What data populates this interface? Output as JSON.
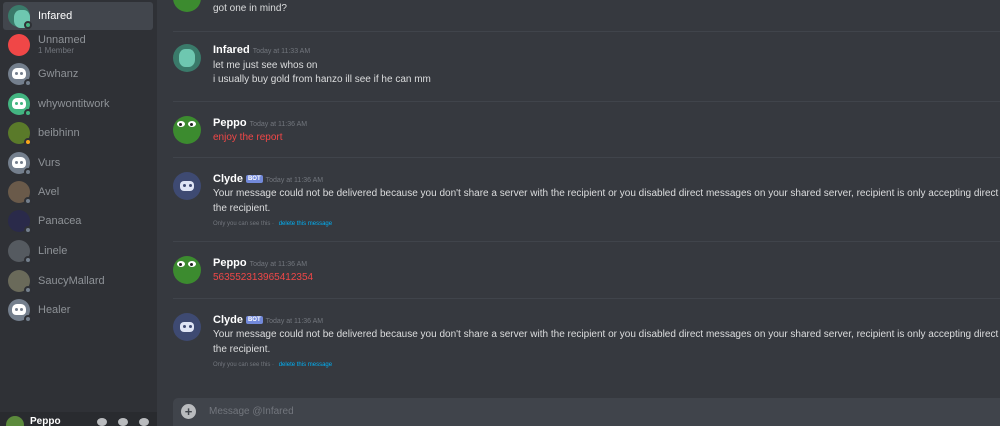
{
  "sidebar": {
    "dms": [
      {
        "name": "Infared",
        "status": "online",
        "avatar_color": "#3a7a6a",
        "active": true
      },
      {
        "name": "Unnamed",
        "sub": "1 Member",
        "avatar_color": "#f04747",
        "group": true
      },
      {
        "name": "Gwhanz",
        "status": "offline",
        "avatar_color": "#747f8d"
      },
      {
        "name": "whywontitwork",
        "status": "online",
        "avatar_color": "#43b581"
      },
      {
        "name": "beibhinn",
        "status": "idle",
        "avatar_color": "#5a7a2a"
      },
      {
        "name": "Vurs",
        "status": "offline",
        "avatar_color": "#747f8d"
      },
      {
        "name": "Avel",
        "status": "offline",
        "avatar_color": "#6a5a4a"
      },
      {
        "name": "Panacea",
        "status": "offline",
        "avatar_color": "#2a2a4a"
      },
      {
        "name": "Linele",
        "status": "offline",
        "avatar_color": "#555a60"
      },
      {
        "name": "SaucyMallard",
        "status": "offline",
        "avatar_color": "#6a6a5a"
      },
      {
        "name": "Healer",
        "status": "offline",
        "avatar_color": "#747f8d"
      }
    ]
  },
  "user": {
    "name": "Peppo"
  },
  "messages": [
    {
      "id": "m0",
      "lines": [
        "got one in mind?"
      ]
    },
    {
      "id": "m1",
      "author": "Infared",
      "timestamp": "Today at 11:33 AM",
      "lines": [
        "let me just see whos on",
        "i usually buy gold from hanzo ill see if he can mm"
      ]
    },
    {
      "id": "m2",
      "author": "Peppo",
      "timestamp": "Today at 11:36 AM",
      "lines": [
        "enjoy the report"
      ]
    },
    {
      "id": "m3",
      "author": "Clyde",
      "badge": "BOT",
      "timestamp": "Today at 11:36 AM",
      "lines": [
        "Your message could not be delivered because you don't share a server with the recipient or you disabled direct messages on your shared server, recipient is only accepting direct",
        "the recipient."
      ],
      "note": "Only you can see this",
      "note_link": "delete this message"
    },
    {
      "id": "m4",
      "author": "Peppo",
      "timestamp": "Today at 11:36 AM",
      "lines": [
        "563552313965412354"
      ]
    },
    {
      "id": "m5",
      "author": "Clyde",
      "badge": "BOT",
      "timestamp": "Today at 11:36 AM",
      "lines": [
        "Your message could not be delivered because you don't share a server with the recipient or you disabled direct messages on your shared server, recipient is only accepting direct",
        "the recipient."
      ],
      "note": "Only you can see this",
      "note_link": "delete this message"
    }
  ],
  "input": {
    "placeholder": "Message @Infared"
  },
  "colors": {
    "background": "#36393f",
    "sidebar": "#2f3136",
    "error_text": "#f04747",
    "link": "#00b0f4",
    "bot_badge": "#7289da"
  }
}
